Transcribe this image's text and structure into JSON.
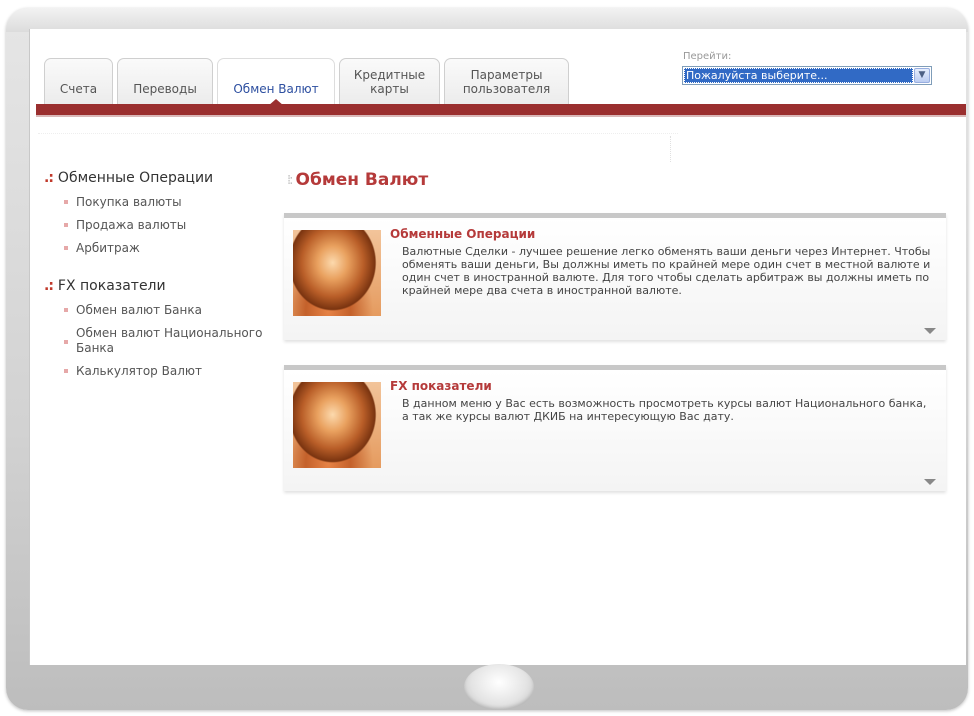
{
  "tabs": [
    {
      "label": "Счета"
    },
    {
      "label": "Переводы"
    },
    {
      "label": "Обмен Валют"
    },
    {
      "label_line1": "Кредитные",
      "label_line2": "карты"
    },
    {
      "label_line1": "Параметры",
      "label_line2": "пользователя"
    }
  ],
  "goto": {
    "label": "Перейти:",
    "selected": "Пожалуйста выберите..."
  },
  "sidebar": {
    "sections": [
      {
        "title": "Обменные Операции",
        "items": [
          "Покупка валюты",
          "Продажа валюты",
          "Арбитраж"
        ]
      },
      {
        "title": "FX показатели",
        "items": [
          "Обмен валют Банка",
          "Обмен валют Национального Банка",
          "Калькулятор Валют"
        ]
      }
    ]
  },
  "main": {
    "title": "Обмен Валют",
    "cards": [
      {
        "title": "Обменные Операции",
        "text": "Валютные Сделки - лучшее решение легко обменять ваши деньги через Интернет. Чтобы обменять ваши деньги, Вы должны иметь по крайней мере один счет в местной валюте и один счет в иностранной валюте. Для того чтобы сделать арбитраж вы должны иметь по крайней мере два счета в иностранной валюте."
      },
      {
        "title": "FX показатели",
        "text": "В данном меню у Вас есть возможность просмотреть курсы валют Национального банка, а так же курсы валют ДКИБ на интересующую Вас дату."
      }
    ]
  },
  "colors": {
    "accent": "#b53a3a",
    "bar": "#9a2f2f",
    "link": "#2d4fa0",
    "select_highlight": "#316ac5"
  },
  "icons": {
    "side_bullet": "red-dots-bullet-icon",
    "list_bullet": "pink-square-bullet-icon",
    "card_expand": "triangle-down-icon",
    "select_arrow": "chevron-down-icon"
  }
}
